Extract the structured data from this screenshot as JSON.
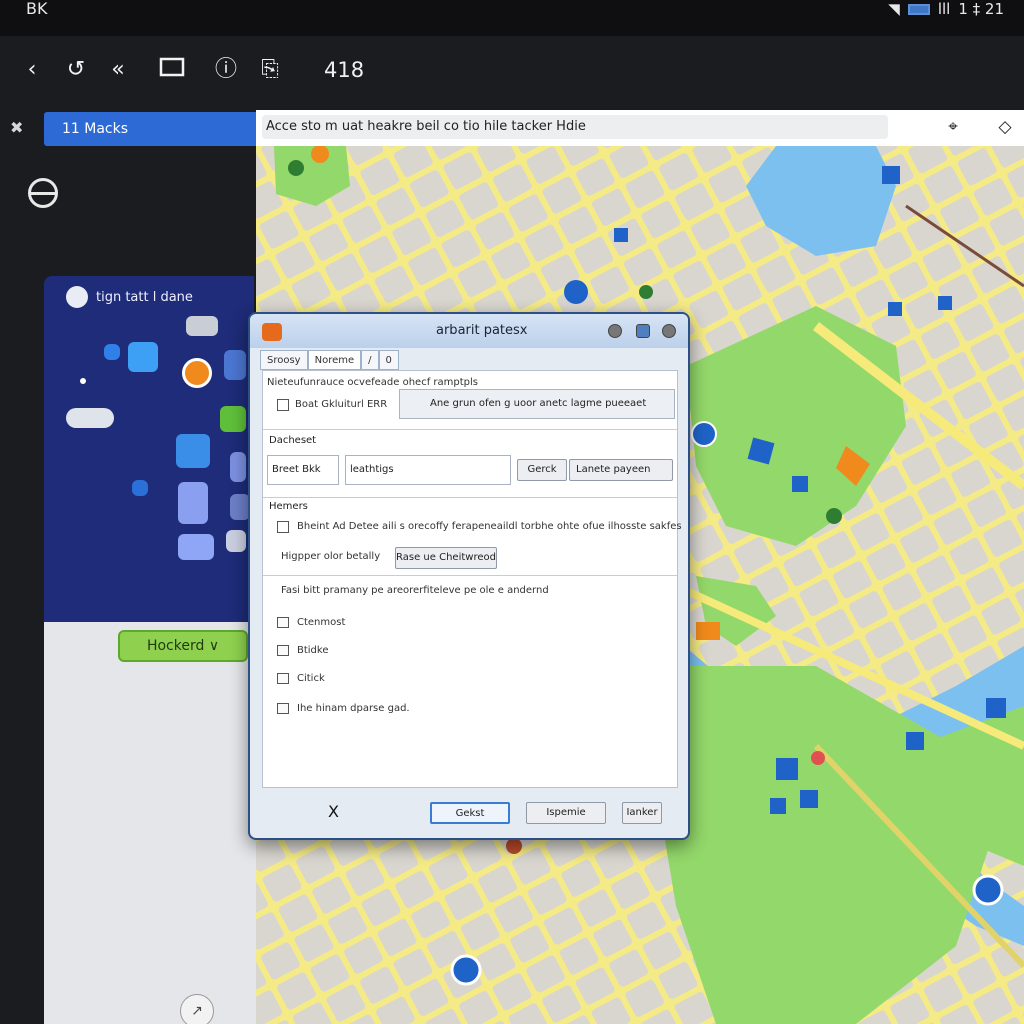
{
  "statusbar": {
    "left_text": "BK",
    "right_text": "1 ‡ 21",
    "bars": "lll"
  },
  "toolbar": {
    "back_icon": "chevron-left-icon",
    "counter_text": "418"
  },
  "left_pane": {
    "tab_label": "11 Macks",
    "panel_title": "tign tatt l dane",
    "dropdown_label": "Hockerd",
    "dropdown_chevron": "∨"
  },
  "address_bar": {
    "value": "Acce sto m uat heakre beil co tio hile tacker Hdie"
  },
  "dialog": {
    "title": "arbarit patesx",
    "tabs": [
      "Sroosy",
      "Noreme",
      "/",
      "0"
    ],
    "row1_header": "Nieteufunrauce ocvefeade ohecf ramptpls",
    "row1_checkbox": "Boat Gkluiturl ERR",
    "row1_combo": "Ane grun ofen g uoor anetc lagme pueeaet",
    "section2_label": "Dacheset",
    "section2_field_label": "Breet Bkk",
    "section2_input": "leathtigs",
    "section2_button": "Gerck",
    "section2_combo": "Lanete payeen",
    "section3_label": "Hemers",
    "section3_row1": "Bheint Ad Detee aili s orecoffy ferapeneaildl torbhe ohte ofue ilhosste sakfes",
    "section3_row2_label": "Higpper olor betally",
    "section3_row2_button": "Rase ue Cheitwreod",
    "section3_row3": "Fasi bitt pramany pe areorerfiteleve pe ole e andernd",
    "list_items": [
      "Ctenmost",
      "Btidke",
      "Citick",
      "Ihe hinam dparse gad."
    ],
    "footer_x": "X",
    "btn_ok": "Gekst",
    "btn_mid": "Ispemie",
    "btn_last": "Ianker"
  },
  "colors": {
    "accent": "#2d6ad6",
    "panel_blue": "#1e2c79",
    "map_green": "#93d86a",
    "map_water": "#7cc0f0",
    "road_yellow": "#f6ea7a"
  }
}
